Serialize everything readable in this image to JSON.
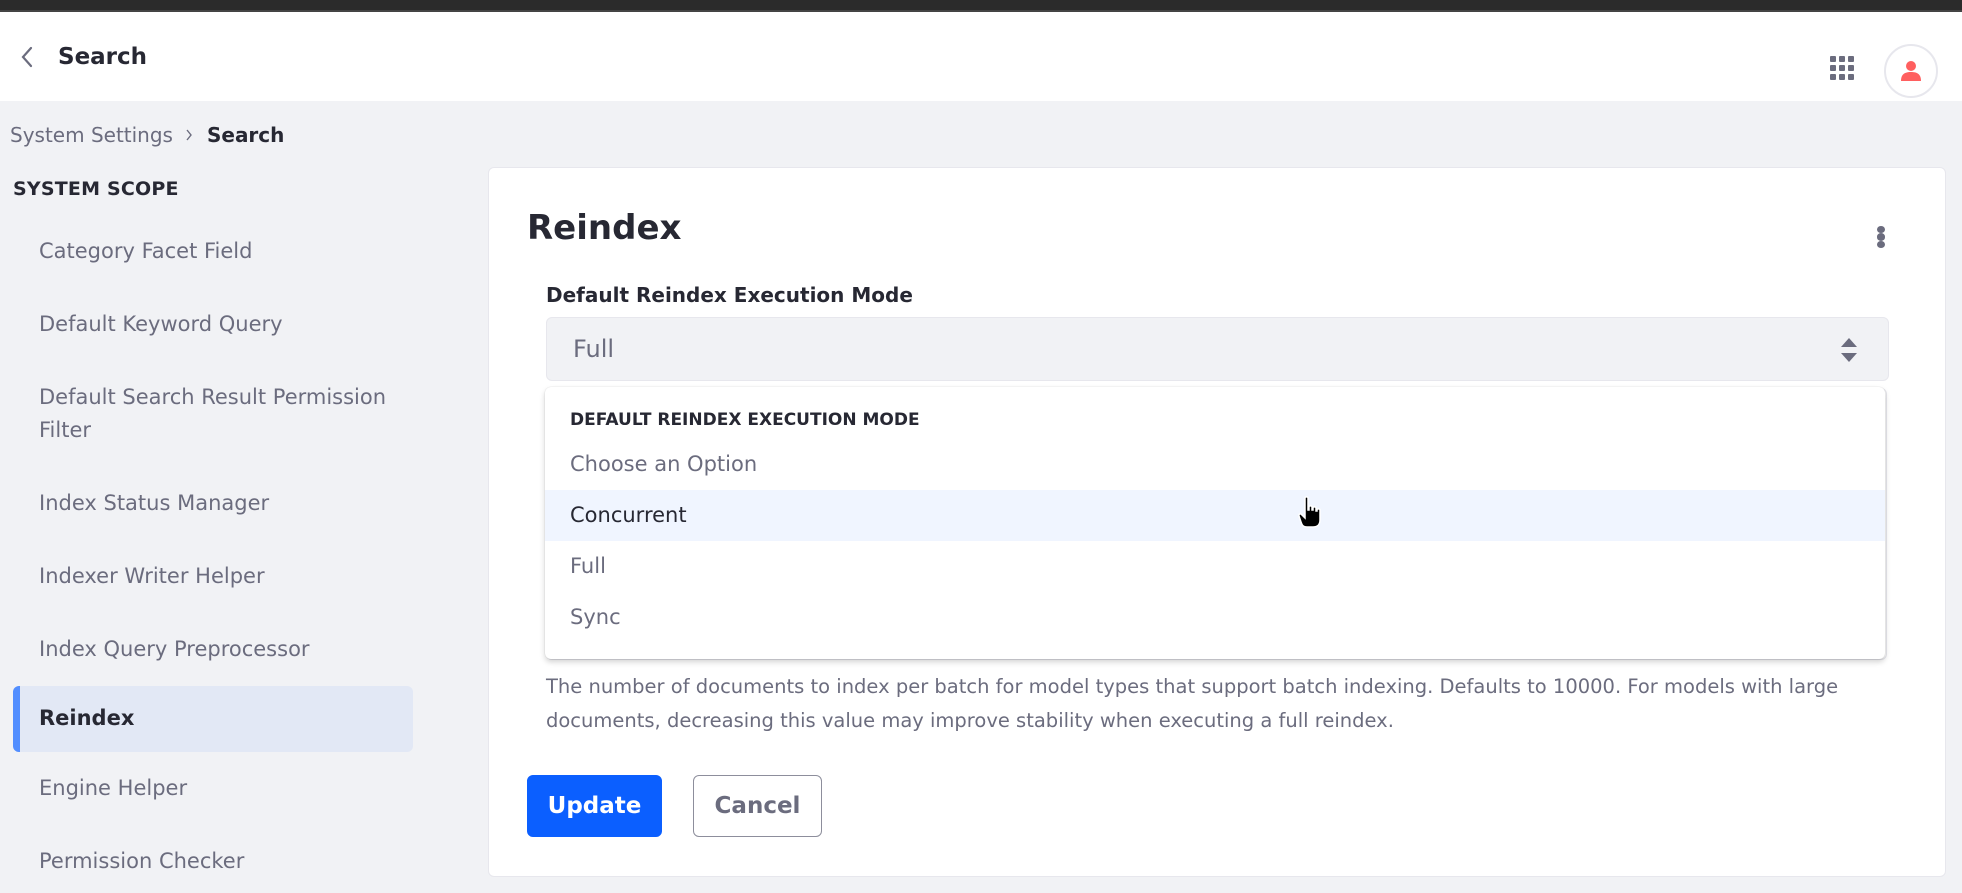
{
  "header": {
    "title": "Search",
    "back_icon": "chevron-left-icon",
    "apps_icon": "grid-icon",
    "user_icon": "user-icon",
    "user_icon_color": "#ff5f5f"
  },
  "breadcrumb": {
    "items": [
      {
        "label": "System Settings"
      },
      {
        "label": "Search"
      }
    ]
  },
  "sidebar": {
    "scope_title": "SYSTEM SCOPE",
    "accent_color": "#528eff",
    "items": [
      {
        "label": "Category Facet Field",
        "active": false
      },
      {
        "label": "Default Keyword Query",
        "active": false
      },
      {
        "label": "Default Search Result Permission Filter",
        "active": false
      },
      {
        "label": "Index Status Manager",
        "active": false
      },
      {
        "label": "Indexer Writer Helper",
        "active": false
      },
      {
        "label": "Index Query Preprocessor",
        "active": false
      },
      {
        "label": "Reindex",
        "active": true
      },
      {
        "label": "Engine Helper",
        "active": false
      },
      {
        "label": "Permission Checker",
        "active": false
      }
    ]
  },
  "main": {
    "title": "Reindex",
    "options_icon": "ellipsis-vertical-icon",
    "field": {
      "label": "Default Reindex Execution Mode",
      "selected_value": "Full"
    },
    "dropdown": {
      "header": "DEFAULT REINDEX EXECUTION MODE",
      "options": [
        {
          "label": "Choose an Option",
          "hovered": false
        },
        {
          "label": "Concurrent",
          "hovered": true
        },
        {
          "label": "Full",
          "hovered": false
        },
        {
          "label": "Sync",
          "hovered": false
        }
      ]
    },
    "help_text": "The number of documents to index per batch for model types that support batch indexing. Defaults to 10000. For models with large documents, decreasing this value may improve stability when executing a full reindex.",
    "buttons": {
      "update_label": "Update",
      "cancel_label": "Cancel",
      "primary_color": "#0b5fff"
    }
  }
}
